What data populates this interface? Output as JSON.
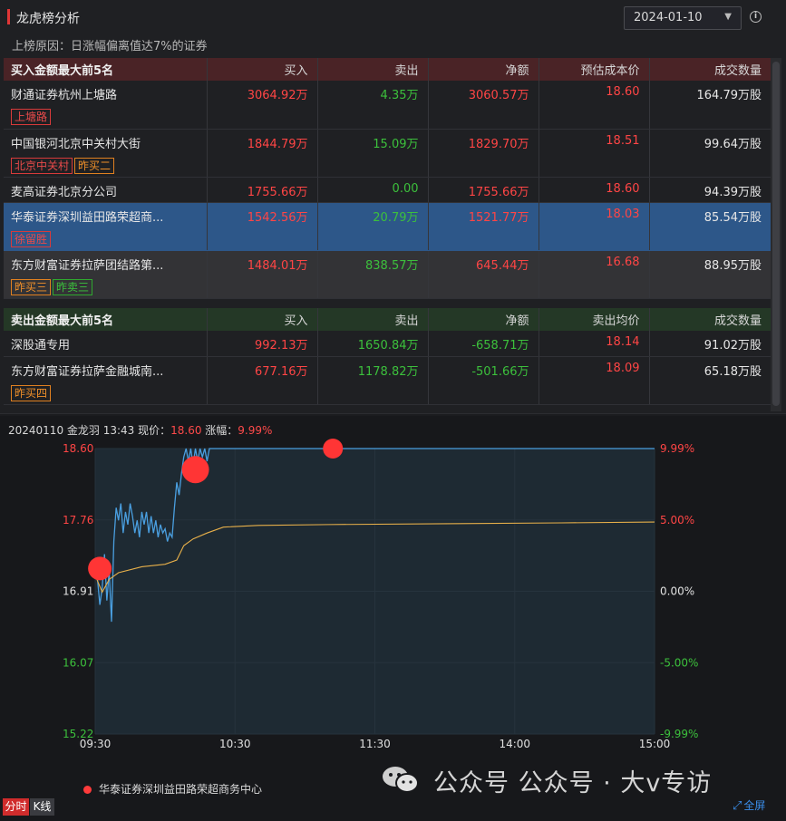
{
  "header": {
    "title": "龙虎榜分析",
    "date": "2024-01-10",
    "reason": "上榜原因：日涨幅偏离值达7%的证券"
  },
  "buy_section": {
    "title": "买入金额最大前5名",
    "columns": [
      "买入",
      "卖出",
      "净额",
      "预估成本价",
      "成交数量"
    ],
    "rows": [
      {
        "name": "财通证券杭州上塘路",
        "buy": "3064.92万",
        "sell": "4.35万",
        "net": "3060.57万",
        "price": "18.60",
        "volume": "164.79万股",
        "tags": [
          {
            "text": "上塘路",
            "color": "red"
          }
        ],
        "state": ""
      },
      {
        "name": "中国银河北京中关村大街",
        "buy": "1844.79万",
        "sell": "15.09万",
        "net": "1829.70万",
        "price": "18.51",
        "volume": "99.64万股",
        "tags": [
          {
            "text": "北京中关村",
            "color": "red"
          },
          {
            "text": "昨买二",
            "color": "orange"
          }
        ],
        "state": ""
      },
      {
        "name": "麦高证券北京分公司",
        "buy": "1755.66万",
        "sell": "0.00",
        "net": "1755.66万",
        "price": "18.60",
        "volume": "94.39万股",
        "tags": [],
        "state": ""
      },
      {
        "name": "华泰证券深圳益田路荣超商...",
        "buy": "1542.56万",
        "sell": "20.79万",
        "net": "1521.77万",
        "price": "18.03",
        "volume": "85.54万股",
        "tags": [
          {
            "text": "徐留胜",
            "color": "red"
          }
        ],
        "state": "selected"
      },
      {
        "name": "东方财富证券拉萨团结路第...",
        "buy": "1484.01万",
        "sell": "838.57万",
        "net": "645.44万",
        "price": "16.68",
        "volume": "88.95万股",
        "tags": [
          {
            "text": "昨买三",
            "color": "orange"
          },
          {
            "text": "昨卖三",
            "color": "green"
          }
        ],
        "state": "dim"
      }
    ]
  },
  "sell_section": {
    "title": "卖出金额最大前5名",
    "columns": [
      "买入",
      "卖出",
      "净额",
      "卖出均价",
      "成交数量"
    ],
    "rows": [
      {
        "name": "深股通专用",
        "buy": "992.13万",
        "sell": "1650.84万",
        "net": "-658.71万",
        "price": "18.14",
        "volume": "91.02万股",
        "tags": []
      },
      {
        "name": "东方财富证券拉萨金融城南...",
        "buy": "677.16万",
        "sell": "1178.82万",
        "net": "-501.66万",
        "price": "18.09",
        "volume": "65.18万股",
        "tags": [
          {
            "text": "昨买四",
            "color": "orange"
          }
        ]
      }
    ]
  },
  "chart": {
    "header_prefix": "20240110 金龙羽 13:43 现价：",
    "price": "18.60",
    "change_label": " 涨幅：",
    "change": "9.99%",
    "legend": "华泰证券深圳益田路荣超商务中心",
    "watermark": "公众号 公众号 · 大v专访",
    "tab_timeshare": "分时",
    "tab_kline": "K线",
    "fullscreen": "全屏",
    "colors": {
      "price_line": "#4a9fe0",
      "avg_line": "#e8b04a",
      "up": "#ff4545",
      "down": "#3cc03c",
      "marker": "#ff3535"
    }
  },
  "chart_data": {
    "type": "line",
    "title": "20240110 金龙羽 13:43",
    "x_tick_labels": [
      "09:30",
      "10:30",
      "11:30",
      "14:00",
      "15:00"
    ],
    "y_left_ticks": [
      "18.60",
      "17.76",
      "16.91",
      "16.07",
      "15.22"
    ],
    "y_right_ticks": [
      "9.99%",
      "5.00%",
      "0.00%",
      "-5.00%",
      "-9.99%"
    ],
    "ylim": [
      15.22,
      18.6
    ],
    "prev_close": 16.91,
    "minutes_total": 240,
    "series": [
      {
        "values": [
          [
            0,
            17.25
          ],
          [
            1,
            17.05
          ],
          [
            2,
            16.75
          ],
          [
            3,
            16.95
          ],
          [
            4,
            17.35
          ],
          [
            5,
            16.8
          ],
          [
            6,
            17.15
          ],
          [
            7,
            16.55
          ],
          [
            8,
            17.5
          ],
          [
            9,
            17.9
          ],
          [
            10,
            17.75
          ],
          [
            11,
            17.95
          ],
          [
            12,
            17.6
          ],
          [
            13,
            17.85
          ],
          [
            14,
            17.7
          ],
          [
            15,
            17.95
          ],
          [
            16,
            17.8
          ],
          [
            17,
            17.6
          ],
          [
            18,
            17.75
          ],
          [
            19,
            17.55
          ],
          [
            20,
            17.85
          ],
          [
            21,
            17.7
          ],
          [
            22,
            17.85
          ],
          [
            23,
            17.6
          ],
          [
            24,
            17.8
          ],
          [
            25,
            17.6
          ],
          [
            26,
            17.75
          ],
          [
            27,
            17.55
          ],
          [
            28,
            17.7
          ],
          [
            29,
            17.6
          ],
          [
            30,
            17.65
          ],
          [
            31,
            17.5
          ],
          [
            32,
            17.6
          ],
          [
            33,
            17.55
          ],
          [
            34,
            17.9
          ],
          [
            35,
            18.2
          ],
          [
            36,
            18.05
          ],
          [
            37,
            18.3
          ],
          [
            38,
            18.5
          ],
          [
            39,
            18.6
          ],
          [
            40,
            18.45
          ],
          [
            41,
            18.6
          ],
          [
            42,
            18.4
          ],
          [
            43,
            18.6
          ],
          [
            44,
            18.45
          ],
          [
            45,
            18.6
          ],
          [
            46,
            18.5
          ],
          [
            47,
            18.6
          ],
          [
            48,
            18.45
          ],
          [
            49,
            18.6
          ],
          [
            50,
            18.6
          ],
          [
            240,
            18.6
          ]
        ]
      },
      {
        "values": [
          [
            0,
            17.1
          ],
          [
            3,
            16.9
          ],
          [
            6,
            17.05
          ],
          [
            10,
            17.13
          ],
          [
            20,
            17.2
          ],
          [
            30,
            17.23
          ],
          [
            35,
            17.28
          ],
          [
            38,
            17.45
          ],
          [
            42,
            17.53
          ],
          [
            48,
            17.6
          ],
          [
            55,
            17.67
          ],
          [
            70,
            17.69
          ],
          [
            100,
            17.7
          ],
          [
            150,
            17.71
          ],
          [
            200,
            17.72
          ],
          [
            240,
            17.73
          ]
        ]
      }
    ],
    "markers": [
      {
        "minute": 2,
        "price": 17.18
      },
      {
        "minute": 43,
        "price": 18.35
      },
      {
        "minute": 102,
        "price": 18.6
      }
    ]
  }
}
